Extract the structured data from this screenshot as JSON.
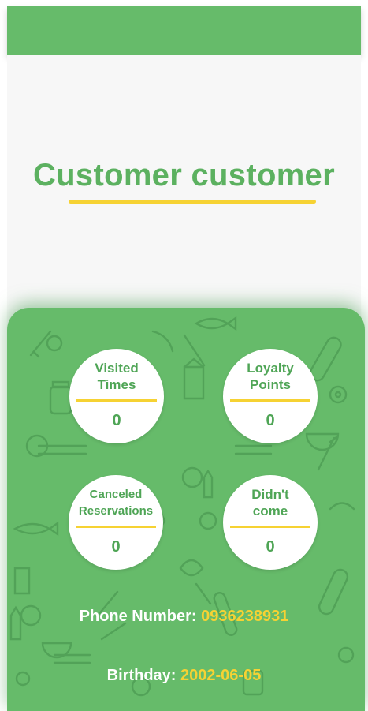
{
  "profile": {
    "name": "Customer customer"
  },
  "stats": [
    {
      "label_line1": "Visited",
      "label_line2": "Times",
      "value": "0"
    },
    {
      "label_line1": "Loyalty",
      "label_line2": "Points",
      "value": "0"
    },
    {
      "label_line1": "Canceled",
      "label_line2": "Reservations",
      "value": "0"
    },
    {
      "label_line1": "Didn't",
      "label_line2": "come",
      "value": "0"
    }
  ],
  "info": {
    "phone_label": "Phone Number:",
    "phone_value": "0936238931",
    "birthday_label": "Birthday:",
    "birthday_value": "2002-06-05"
  },
  "colors": {
    "primary_green": "#66bb6a",
    "title_green": "#5cb160",
    "accent_yellow": "#f6d233"
  },
  "icons": [
    "grocery-pattern-background"
  ]
}
